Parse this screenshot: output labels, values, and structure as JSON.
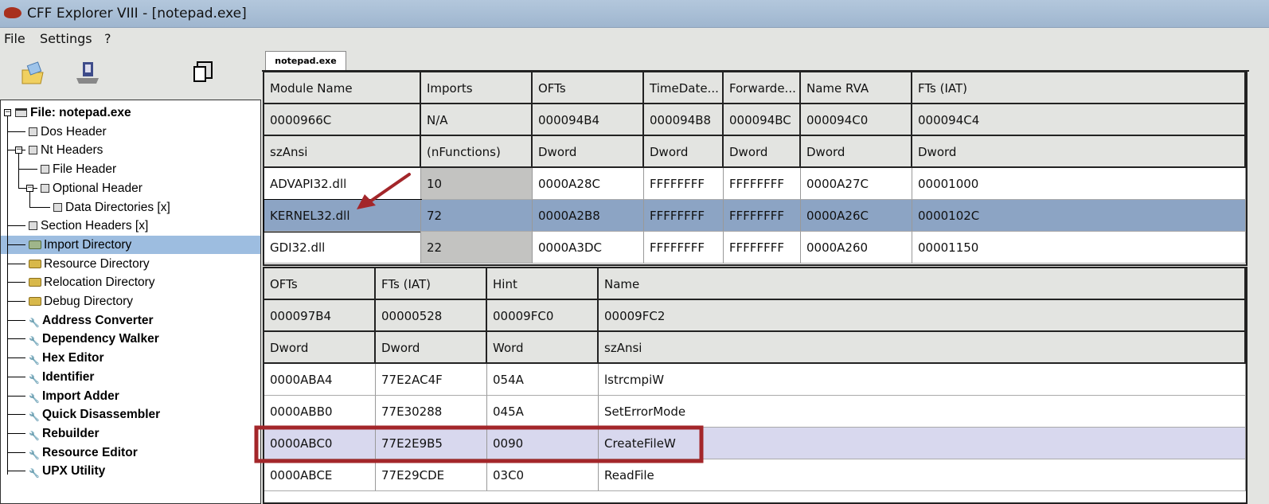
{
  "window": {
    "title": "CFF Explorer VIII - [notepad.exe]"
  },
  "menu": [
    "File",
    "Settings",
    "?"
  ],
  "toolbar": {
    "icons": [
      "open-folder-icon",
      "save-disk-icon",
      "windows-icon"
    ]
  },
  "tab": {
    "label": "notepad.exe"
  },
  "tree": [
    {
      "label": "File: notepad.exe",
      "icon": "window",
      "bold": true,
      "level": 0
    },
    {
      "label": "Dos Header",
      "icon": "doc",
      "level": 1
    },
    {
      "label": "Nt Headers",
      "icon": "doc",
      "level": 1
    },
    {
      "label": "File Header",
      "icon": "doc",
      "level": 2
    },
    {
      "label": "Optional Header",
      "icon": "doc",
      "level": 2
    },
    {
      "label": "Data Directories [x]",
      "icon": "doc",
      "level": 3
    },
    {
      "label": "Section Headers [x]",
      "icon": "doc",
      "level": 1
    },
    {
      "label": "Import Directory",
      "icon": "folder-open",
      "level": 1,
      "selected": true
    },
    {
      "label": "Resource Directory",
      "icon": "folder",
      "level": 1
    },
    {
      "label": "Relocation Directory",
      "icon": "folder",
      "level": 1
    },
    {
      "label": "Debug Directory",
      "icon": "folder",
      "level": 1
    },
    {
      "label": "Address Converter",
      "icon": "tool",
      "bold": true,
      "level": 1
    },
    {
      "label": "Dependency Walker",
      "icon": "tool",
      "bold": true,
      "level": 1
    },
    {
      "label": "Hex Editor",
      "icon": "tool",
      "bold": true,
      "level": 1
    },
    {
      "label": "Identifier",
      "icon": "tool",
      "bold": true,
      "level": 1
    },
    {
      "label": "Import Adder",
      "icon": "tool",
      "bold": true,
      "level": 1
    },
    {
      "label": "Quick Disassembler",
      "icon": "tool",
      "bold": true,
      "level": 1
    },
    {
      "label": "Rebuilder",
      "icon": "tool",
      "bold": true,
      "level": 1
    },
    {
      "label": "Resource Editor",
      "icon": "tool",
      "bold": true,
      "level": 1
    },
    {
      "label": "UPX Utility",
      "icon": "tool",
      "bold": true,
      "level": 1
    }
  ],
  "modules_table": {
    "header_rows": [
      [
        "Module Name",
        "Imports",
        "OFTs",
        "TimeDate...",
        "Forwarde...",
        "Name RVA",
        "FTs (IAT)"
      ],
      [
        "0000966C",
        "N/A",
        "000094B4",
        "000094B8",
        "000094BC",
        "000094C0",
        "000094C4"
      ],
      [
        "szAnsi",
        "(nFunctions)",
        "Dword",
        "Dword",
        "Dword",
        "Dword",
        "Dword"
      ]
    ],
    "rows": [
      [
        "ADVAPI32.dll",
        "10",
        "0000A28C",
        "FFFFFFFF",
        "FFFFFFFF",
        "0000A27C",
        "00001000"
      ],
      [
        "KERNEL32.dll",
        "72",
        "0000A2B8",
        "FFFFFFFF",
        "FFFFFFFF",
        "0000A26C",
        "0000102C"
      ],
      [
        "GDI32.dll",
        "22",
        "0000A3DC",
        "FFFFFFFF",
        "FFFFFFFF",
        "0000A260",
        "00001150"
      ]
    ],
    "selected_row": 1
  },
  "functions_table": {
    "header_rows": [
      [
        "OFTs",
        "FTs (IAT)",
        "Hint",
        "Name"
      ],
      [
        "000097B4",
        "00000528",
        "00009FC0",
        "00009FC2"
      ],
      [
        "Dword",
        "Dword",
        "Word",
        "szAnsi"
      ]
    ],
    "rows": [
      [
        "0000ABA4",
        "77E2AC4F",
        "054A",
        "lstrcmpiW"
      ],
      [
        "0000ABB0",
        "77E30288",
        "045A",
        "SetErrorMode"
      ],
      [
        "0000ABC0",
        "77E2E9B5",
        "0090",
        "CreateFileW"
      ],
      [
        "0000ABCE",
        "77E29CDE",
        "03C0",
        "ReadFile"
      ]
    ],
    "highlighted_row": 2
  },
  "colors": {
    "selection": "#8ca4c4",
    "tree_selection": "#9dbde0",
    "annotation": "#a3262a",
    "highlight": "#d8d8ee"
  }
}
